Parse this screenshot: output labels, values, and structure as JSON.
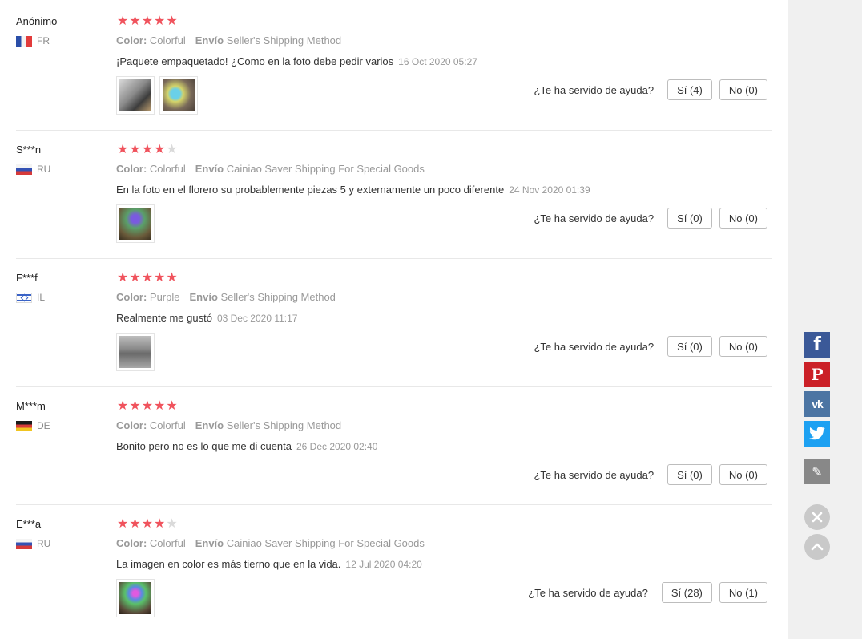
{
  "reviews": [
    {
      "user": "Anónimo",
      "country": "FR",
      "stars": 5,
      "color_label": "Color:",
      "color_value": "Colorful",
      "shipping_label": "Envío",
      "shipping_value": "Seller's Shipping Method",
      "text": "¡Paquete empaquetado! ¿Como en la foto debe pedir varios",
      "date": "16 Oct 2020 05:27",
      "photos": 2,
      "helpful_label": "¿Te ha servido de ayuda?",
      "yes_label": "Sí (4)",
      "no_label": "No (0)"
    },
    {
      "user": "S***n",
      "country": "RU",
      "stars": 4,
      "color_label": "Color:",
      "color_value": "Colorful",
      "shipping_label": "Envío",
      "shipping_value": "Cainiao Saver Shipping For Special Goods",
      "text": "En la foto en el florero su probablemente piezas 5 y externamente un poco diferente",
      "date": "24 Nov 2020 01:39",
      "photos": 1,
      "helpful_label": "¿Te ha servido de ayuda?",
      "yes_label": "Sí (0)",
      "no_label": "No (0)"
    },
    {
      "user": "F***f",
      "country": "IL",
      "stars": 5,
      "color_label": "Color:",
      "color_value": "Purple",
      "shipping_label": "Envío",
      "shipping_value": "Seller's Shipping Method",
      "text": "Realmente me gustó",
      "date": "03 Dec 2020 11:17",
      "photos": 1,
      "helpful_label": "¿Te ha servido de ayuda?",
      "yes_label": "Sí (0)",
      "no_label": "No (0)"
    },
    {
      "user": "M***m",
      "country": "DE",
      "stars": 5,
      "color_label": "Color:",
      "color_value": "Colorful",
      "shipping_label": "Envío",
      "shipping_value": "Seller's Shipping Method",
      "text": "Bonito pero no es lo que me di cuenta",
      "date": "26 Dec 2020 02:40",
      "photos": 0,
      "helpful_label": "¿Te ha servido de ayuda?",
      "yes_label": "Sí (0)",
      "no_label": "No (0)"
    },
    {
      "user": "E***a",
      "country": "RU",
      "stars": 4,
      "color_label": "Color:",
      "color_value": "Colorful",
      "shipping_label": "Envío",
      "shipping_value": "Cainiao Saver Shipping For Special Goods",
      "text": "La imagen en color es más tierno que en la vida.",
      "date": "12 Jul 2020 04:20",
      "photos": 1,
      "helpful_label": "¿Te ha servido de ayuda?",
      "yes_label": "Sí (28)",
      "no_label": "No (1)"
    }
  ],
  "share_bar": {
    "buttons": [
      {
        "icon": "facebook-icon",
        "glyph": "f",
        "color": "#3b5998"
      },
      {
        "icon": "pinterest-icon",
        "glyph": "P",
        "color": "#cb2027"
      },
      {
        "icon": "vk-icon",
        "glyph": "vk",
        "color": "#4c75a3"
      },
      {
        "icon": "twitter-icon",
        "glyph": "t",
        "color": "#1da1f2"
      },
      {
        "icon": "edit-icon",
        "glyph": "✎",
        "color": "#888888"
      }
    ],
    "close_icon": "close-icon",
    "scroll_top_icon": "chevron-up-icon"
  }
}
